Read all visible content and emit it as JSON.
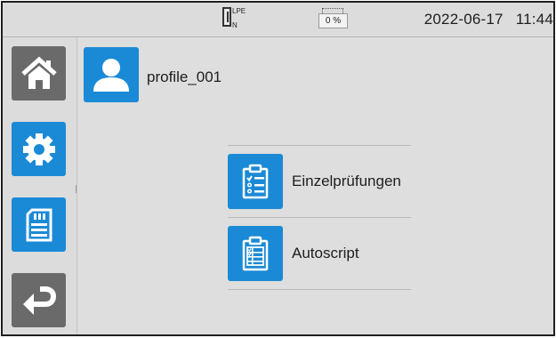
{
  "status_bar": {
    "phase_labels": {
      "l": "L",
      "pe": "PE",
      "n": "N"
    },
    "battery_percent": "0 %",
    "date": "2022-06-17",
    "time": "11:44"
  },
  "sidebar": {
    "items": [
      {
        "icon": "home-icon"
      },
      {
        "icon": "gear-icon"
      },
      {
        "icon": "sd-card-icon"
      },
      {
        "icon": "return-arrow-icon"
      }
    ]
  },
  "profile": {
    "icon": "user-icon",
    "name": "profile_001"
  },
  "menu": {
    "items": [
      {
        "label": "Einzelprüfungen",
        "icon": "checklist-clipboard-icon"
      },
      {
        "label": "Autoscript",
        "icon": "script-clipboard-icon"
      }
    ]
  },
  "colors": {
    "accent": "#1b8ad6",
    "nav_gray": "#6a6a6a",
    "background": "#dedede"
  }
}
